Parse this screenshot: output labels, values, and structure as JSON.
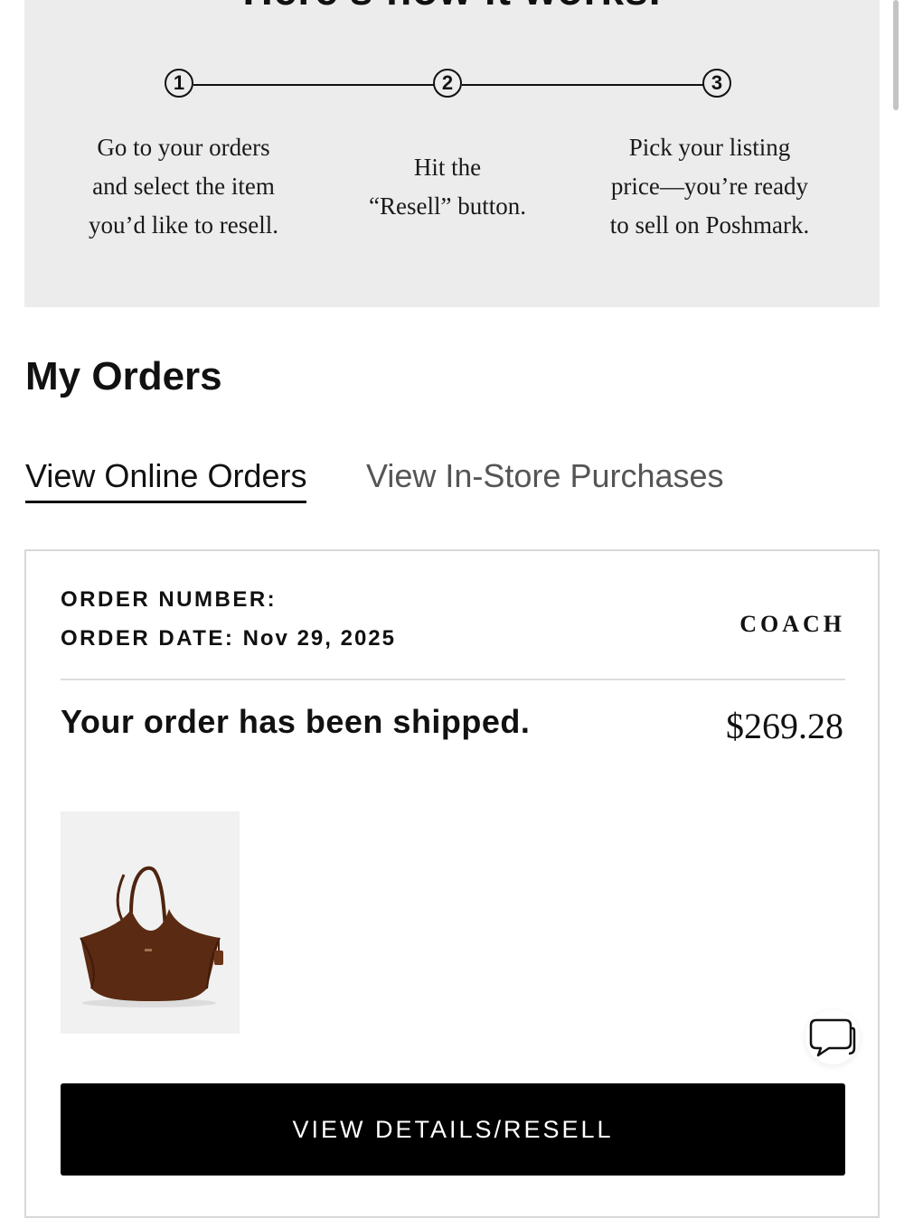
{
  "promo": {
    "heading": "Here's how it works.",
    "steps": [
      {
        "number": "1",
        "lines": [
          "Go to your orders",
          "and select the item",
          "you’d like to resell."
        ]
      },
      {
        "number": "2",
        "lines": [
          "Hit the",
          "“Resell” button."
        ]
      },
      {
        "number": "3",
        "lines": [
          "Pick your listing",
          "price—you’re ready",
          "to sell on Poshmark."
        ]
      }
    ]
  },
  "orders": {
    "title": "My Orders",
    "tabs": [
      {
        "label": "View Online Orders",
        "active": true
      },
      {
        "label": "View In-Store Purchases",
        "active": false
      }
    ],
    "order": {
      "number_label": "ORDER NUMBER:",
      "number_value": "",
      "date_label": "ORDER DATE:",
      "date_value": "Nov 29, 2025",
      "brand": "COACH",
      "status": "Your order has been shipped.",
      "price": "$269.28",
      "product_image_icon": "suede-tote-bag-image",
      "action_label": "VIEW DETAILS/RESELL"
    },
    "chat_icon": "chat-bubble-icon"
  },
  "colors": {
    "promo_bg": "#ececec",
    "button_bg": "#000000",
    "bag_brown": "#5a2a12"
  }
}
